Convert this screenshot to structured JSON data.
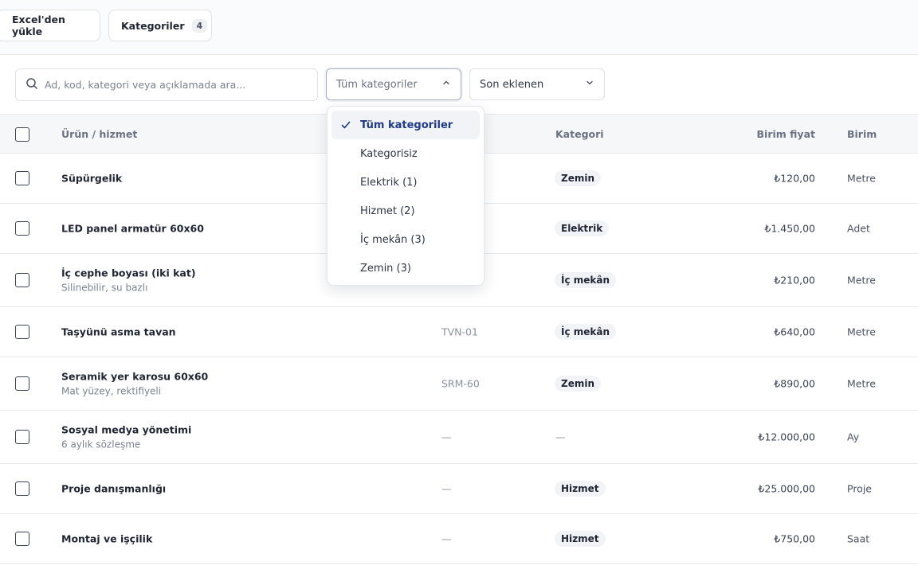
{
  "topbar": {
    "excel_label": "Excel'den yükle",
    "categories_label": "Kategoriler",
    "categories_count": "4"
  },
  "filters": {
    "search_placeholder": "Ad, kod, kategori veya açıklamada ara...",
    "category_select": "Tüm kategoriler",
    "sort_select": "Son eklenen"
  },
  "dropdown": {
    "options": [
      {
        "label": "Tüm kategoriler",
        "selected": true
      },
      {
        "label": "Kategorisiz",
        "selected": false
      },
      {
        "label": "Elektrik (1)",
        "selected": false
      },
      {
        "label": "Hizmet (2)",
        "selected": false
      },
      {
        "label": "İç mekân (3)",
        "selected": false
      },
      {
        "label": "Zemin (3)",
        "selected": false
      }
    ]
  },
  "table": {
    "headers": {
      "name": "Ürün / hizmet",
      "category": "Kategori",
      "price": "Birim fiyat",
      "unit": "Birim"
    },
    "rows": [
      {
        "name": "Süpürgelik",
        "sub": "",
        "code": "",
        "category": "Zemin",
        "price": "₺120,00",
        "unit": "Metre"
      },
      {
        "name": "LED panel armatür 60x60",
        "sub": "",
        "code": "",
        "category": "Elektrik",
        "price": "₺1.450,00",
        "unit": "Adet"
      },
      {
        "name": "İç cephe boyası (iki kat)",
        "sub": "Silinebilir, su bazlı",
        "code": "",
        "category": "İç mekân",
        "price": "₺210,00",
        "unit": "Metre"
      },
      {
        "name": "Taşyünü asma tavan",
        "sub": "",
        "code": "TVN-01",
        "category": "İç mekân",
        "price": "₺640,00",
        "unit": "Metre"
      },
      {
        "name": "Seramik yer karosu 60x60",
        "sub": "Mat yüzey, rektifiyeli",
        "code": "SRM-60",
        "category": "Zemin",
        "price": "₺890,00",
        "unit": "Metre"
      },
      {
        "name": "Sosyal medya yönetimi",
        "sub": "6 aylık sözleşme",
        "code": "—",
        "category": "—",
        "price": "₺12.000,00",
        "unit": "Ay"
      },
      {
        "name": "Proje danışmanlığı",
        "sub": "",
        "code": "—",
        "category": "Hizmet",
        "price": "₺25.000,00",
        "unit": "Proje"
      },
      {
        "name": "Montaj ve işçilik",
        "sub": "",
        "code": "—",
        "category": "Hizmet",
        "price": "₺750,00",
        "unit": "Saat"
      }
    ]
  }
}
